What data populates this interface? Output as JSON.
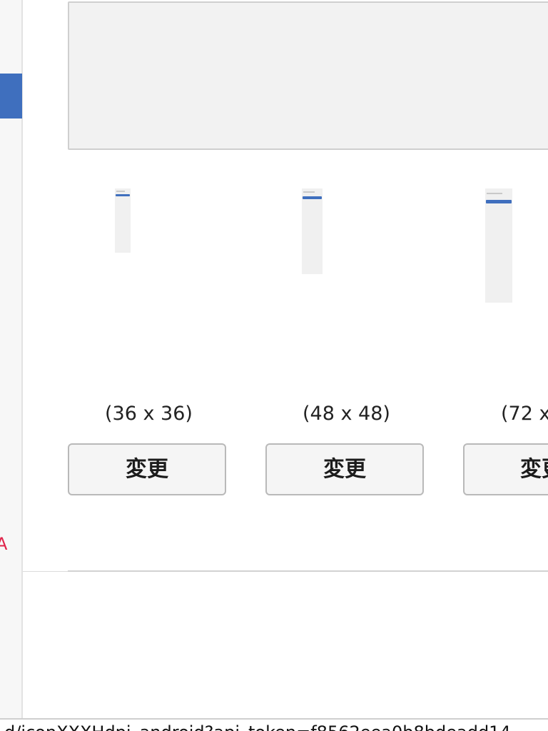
{
  "sidebar": {
    "active_color": "#3f6fbe",
    "partial_mark": "A",
    "partial_mark_color": "#e0234a"
  },
  "preview": {
    "background": "#f2f2f2"
  },
  "icon_sizes": [
    {
      "label": "(36 x 36)",
      "button_label": "変更"
    },
    {
      "label": "(48 x 48)",
      "button_label": "変更"
    },
    {
      "label": "(72 x",
      "button_label": "変更"
    }
  ],
  "status_bar": {
    "url": "d/iconXXXHdpi_android?api_token=f8562eea0b8bdeadd14"
  },
  "colors": {
    "accent": "#3f6fbe",
    "button_background": "#f5f5f5",
    "button_border": "#b9b9b9"
  }
}
